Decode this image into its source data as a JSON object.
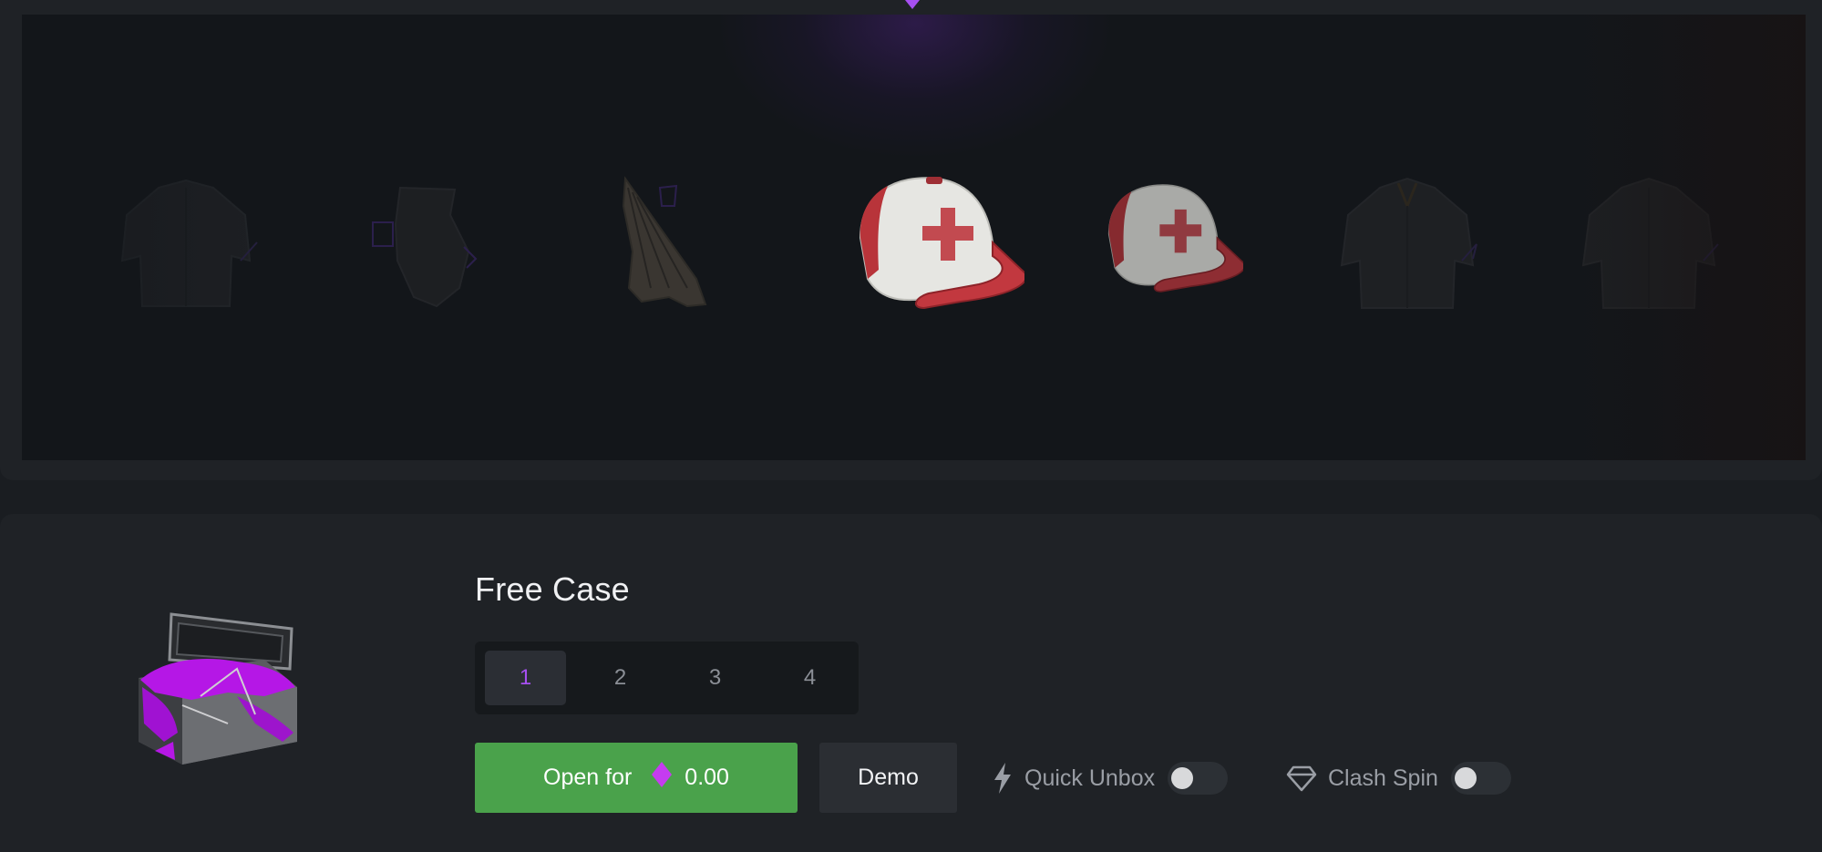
{
  "spinner": {
    "items": [
      {
        "name": "shirt"
      },
      {
        "name": "bandana"
      },
      {
        "name": "cloth-scraps"
      },
      {
        "name": "red-cross-cap"
      },
      {
        "name": "red-cross-cap"
      },
      {
        "name": "jacket"
      },
      {
        "name": "jacket"
      }
    ],
    "accent_color": "#a64ff0"
  },
  "case": {
    "title": "Free Case",
    "quantities": [
      "1",
      "2",
      "3",
      "4"
    ],
    "selected_quantity": "1",
    "open_label": "Open for",
    "price": "0.00",
    "demo_label": "Demo",
    "quick_unbox_label": "Quick Unbox",
    "quick_unbox_on": false,
    "clash_spin_label": "Clash Spin",
    "clash_spin_on": false
  },
  "colors": {
    "open_button": "#4aa24b",
    "gem": "#c53cf0",
    "background": "#1a1d21"
  },
  "icons": {
    "bolt": "lightning-icon",
    "clash": "diamond-outline-icon",
    "currency": "gem-icon"
  }
}
